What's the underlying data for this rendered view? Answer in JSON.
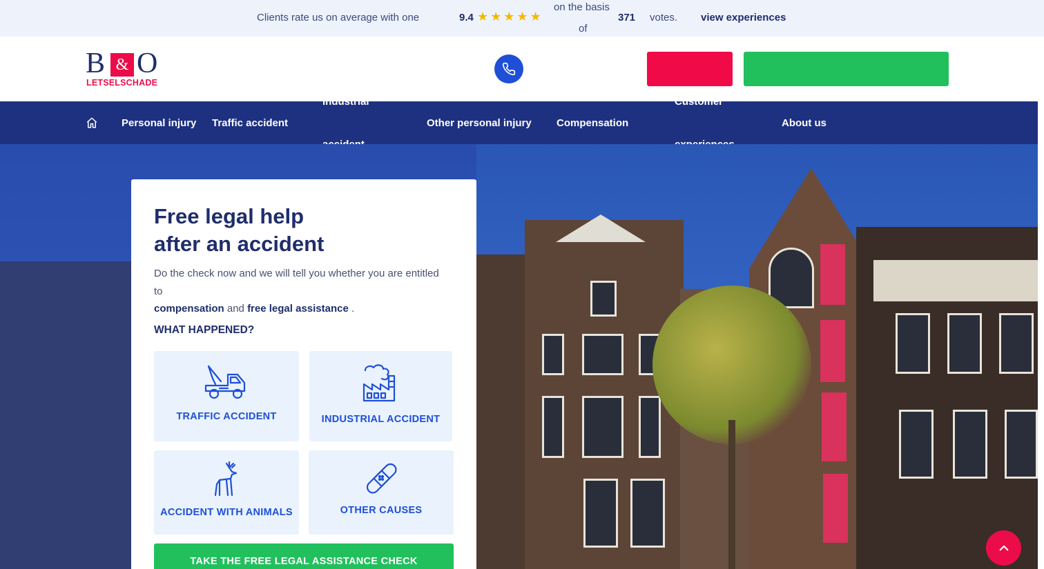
{
  "rating_bar": {
    "text": "Clients rate us on average with one",
    "score": "9.4",
    "stars": "★★★★★",
    "basis_line1": "on the basis",
    "basis_line2": "of",
    "votes_count": "371",
    "votes_label": "votes.",
    "link": "view experiences"
  },
  "header": {
    "logo_b": "B",
    "logo_amp": "&",
    "logo_o": "O",
    "logo_sub": "LETSELSCHADE",
    "phone_icon": "phone-icon",
    "red_button_label": "",
    "green_button_label": ""
  },
  "nav": {
    "home_icon": "home-icon",
    "items": [
      {
        "label": "Personal injury"
      },
      {
        "label": "Traffic accident"
      },
      {
        "label_line1": "Industrial",
        "label_line2": "accident"
      },
      {
        "label": "Other personal injury"
      },
      {
        "label": "Compensation"
      },
      {
        "label_line1": "Customer",
        "label_line2": "experiences"
      },
      {
        "label": "About us"
      }
    ]
  },
  "card": {
    "title_line1": "Free legal help",
    "title_line2": "after an accident",
    "intro_text": "Do the check now and we will tell you whether you are entitled to",
    "intro_bold1": "compensation",
    "intro_and": "and",
    "intro_bold2": "free legal assistance",
    "intro_end": ".",
    "question": "WHAT HAPPENED?",
    "options": [
      {
        "label": "TRAFFIC ACCIDENT",
        "icon": "tow-truck-icon"
      },
      {
        "label": "INDUSTRIAL ACCIDENT",
        "icon": "factory-icon"
      },
      {
        "label": "ACCIDENT WITH ANIMALS",
        "icon": "deer-icon"
      },
      {
        "label": "OTHER CAUSES",
        "icon": "bandage-icon"
      }
    ],
    "cta": "TAKE THE FREE LEGAL ASSISTANCE CHECK"
  },
  "scroll_top_icon": "chevron-up-icon",
  "colors": {
    "navy": "#1f2d6b",
    "nav_bg": "#1e3180",
    "brand_red": "#ec0c4a",
    "green": "#21c05d",
    "blue": "#1e4fd6",
    "option_bg": "#eaf2fd",
    "star": "#f5b800"
  }
}
